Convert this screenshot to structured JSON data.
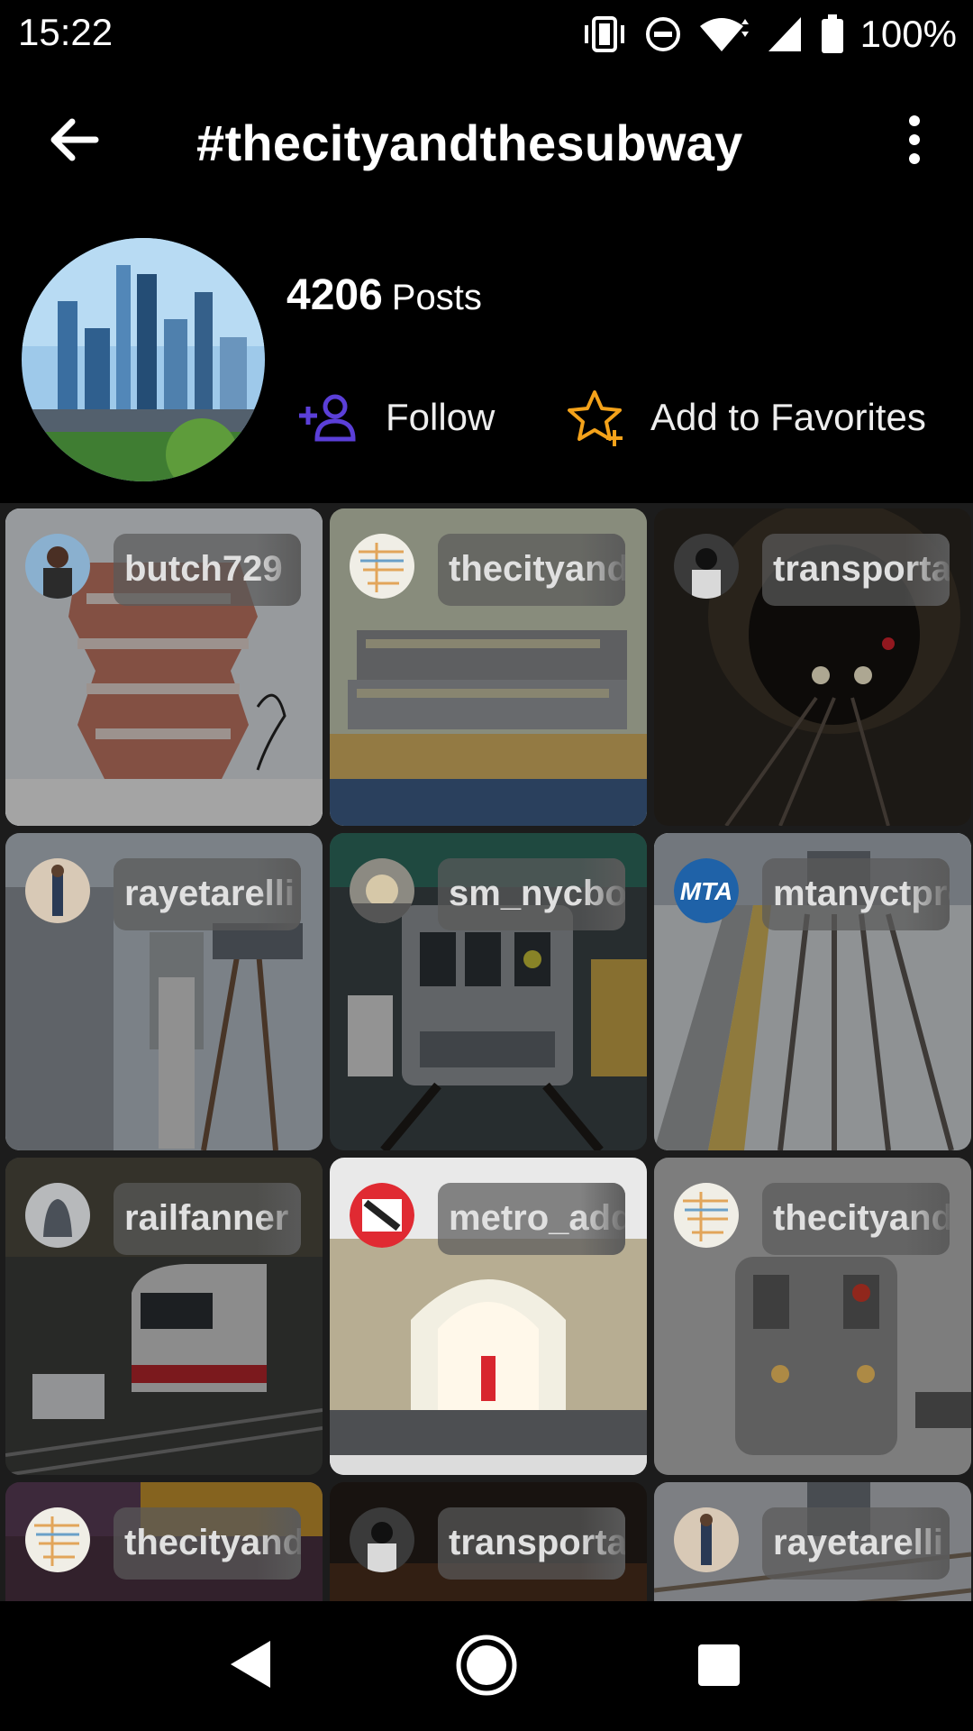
{
  "status_bar": {
    "time": "15:22",
    "battery": "100%",
    "icons": [
      "vibrate-icon",
      "do-not-disturb-icon",
      "wifi-icon",
      "signal-icon",
      "battery-icon"
    ]
  },
  "app_bar": {
    "title": "#thecityandthesubway",
    "back_icon": "arrow-left-icon",
    "menu_icon": "more-vertical-icon"
  },
  "profile": {
    "posts_count": "4206",
    "posts_label": "Posts",
    "follow_label": "Follow",
    "favorites_label": "Add to Favorites"
  },
  "colors": {
    "follow_icon": "#5b3fd8",
    "favorites_icon": "#f4a21a",
    "background": "#000000"
  },
  "grid": {
    "posts": [
      {
        "user": "butch729"
      },
      {
        "user": "thecityandthesubway"
      },
      {
        "user": "transportation"
      },
      {
        "user": "rayetarelli"
      },
      {
        "user": "sm_nycbound"
      },
      {
        "user": "mtanyctproud"
      },
      {
        "user": "railfanner"
      },
      {
        "user": "metro_addict"
      },
      {
        "user": "thecityandthesubway"
      },
      {
        "user": "thecityandthesubway"
      },
      {
        "user": "transportation"
      },
      {
        "user": "rayetarelli"
      }
    ]
  },
  "nav_bar": {
    "icons": [
      "nav-back-icon",
      "nav-home-icon",
      "nav-recents-icon"
    ]
  }
}
